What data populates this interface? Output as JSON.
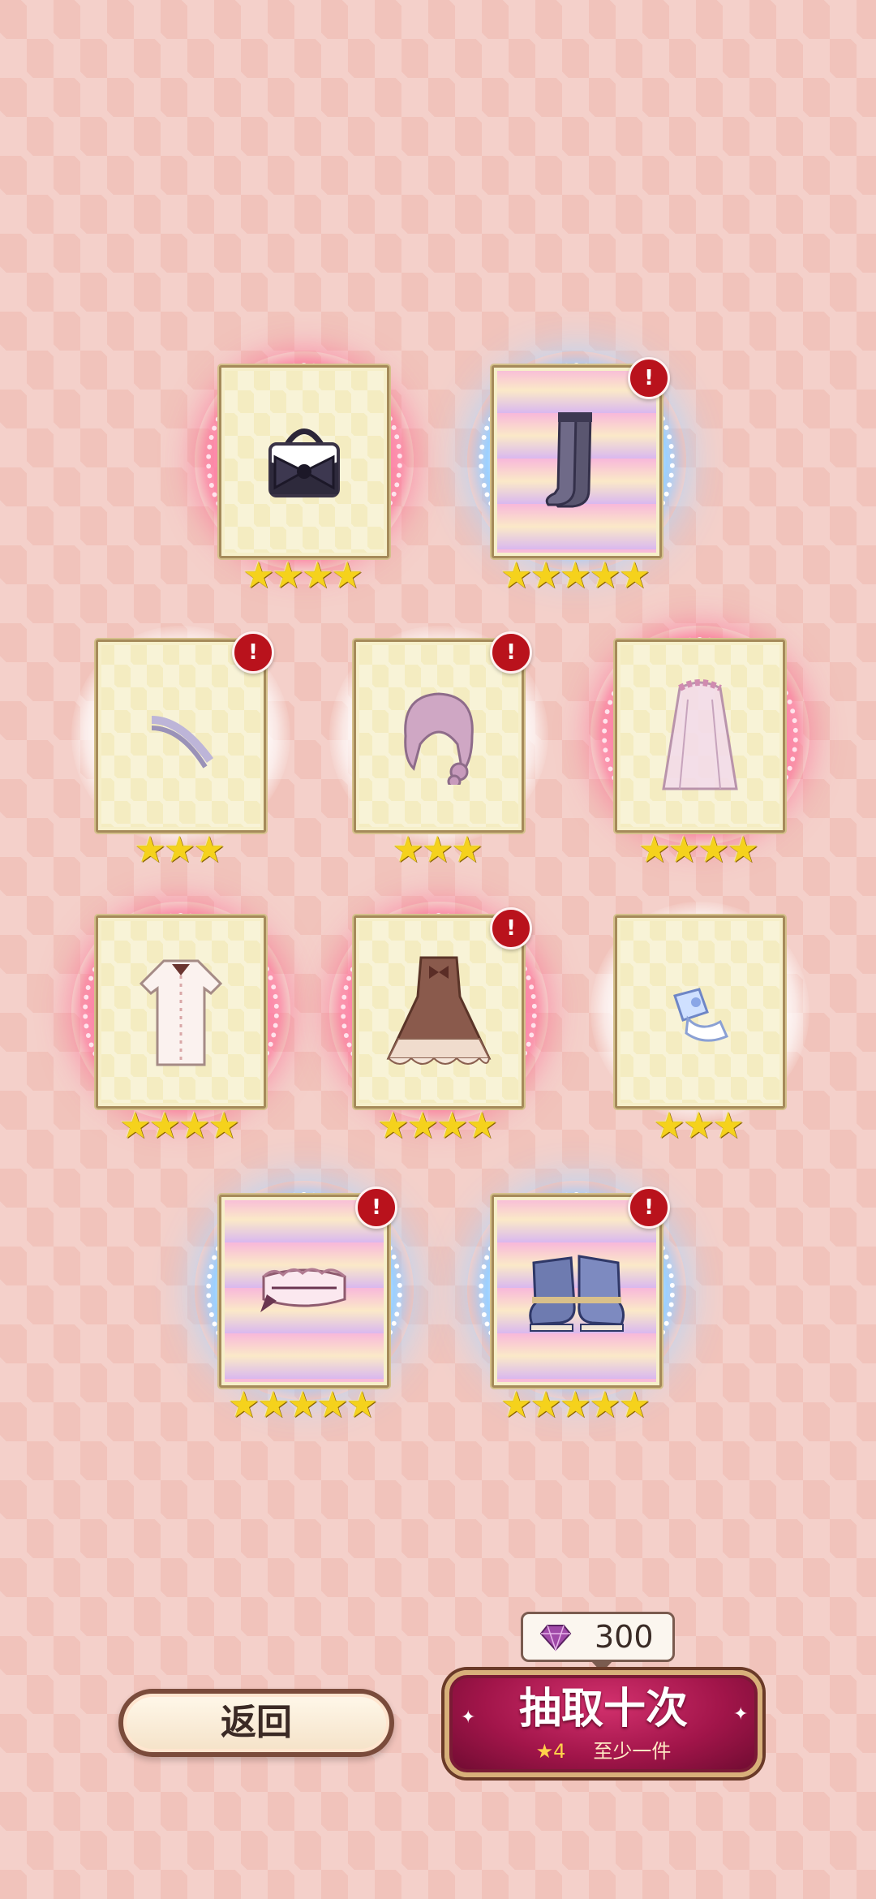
{
  "results": [
    {
      "item": "handbag",
      "frame": "pink",
      "rare": false,
      "new": false,
      "stars": "★★★★",
      "star_count": 4,
      "icon": "handbag-icon"
    },
    {
      "item": "stockings",
      "frame": "blue",
      "rare": true,
      "new": true,
      "stars": "★★★★★",
      "star_count": 5,
      "icon": "stockings-icon"
    },
    {
      "item": "hairband",
      "frame": "white",
      "rare": false,
      "new": true,
      "stars": "★★★",
      "star_count": 3,
      "icon": "hairband-icon"
    },
    {
      "item": "wig",
      "frame": "white",
      "rare": false,
      "new": true,
      "stars": "★★★",
      "star_count": 3,
      "icon": "wig-icon"
    },
    {
      "item": "veil",
      "frame": "pink",
      "rare": false,
      "new": false,
      "stars": "★★★★",
      "star_count": 4,
      "icon": "veil-icon"
    },
    {
      "item": "blouse",
      "frame": "pink",
      "rare": false,
      "new": false,
      "stars": "★★★★",
      "star_count": 4,
      "icon": "blouse-icon"
    },
    {
      "item": "dress",
      "frame": "pink",
      "rare": false,
      "new": true,
      "stars": "★★★★",
      "star_count": 4,
      "icon": "dress-icon"
    },
    {
      "item": "wrist-cuffs",
      "frame": "white",
      "rare": false,
      "new": false,
      "stars": "★★★",
      "star_count": 3,
      "icon": "wrist-cuff-icon"
    },
    {
      "item": "frilled-garter",
      "frame": "blue",
      "rare": true,
      "new": true,
      "stars": "★★★★★",
      "star_count": 5,
      "icon": "garter-icon"
    },
    {
      "item": "shoes",
      "frame": "blue",
      "rare": true,
      "new": true,
      "stars": "★★★★★",
      "star_count": 5,
      "icon": "shoes-icon"
    }
  ],
  "badge_symbol": "!",
  "back_button": {
    "label": "返回"
  },
  "draw_button": {
    "label": "抽取十次",
    "guarantee_star": "★4",
    "guarantee_text": "至少一件",
    "cost": "300",
    "currency_icon": "gem-icon"
  },
  "colors": {
    "badge": "#b9121c",
    "draw_button": "#a2154a",
    "star": "#f5d21c"
  }
}
